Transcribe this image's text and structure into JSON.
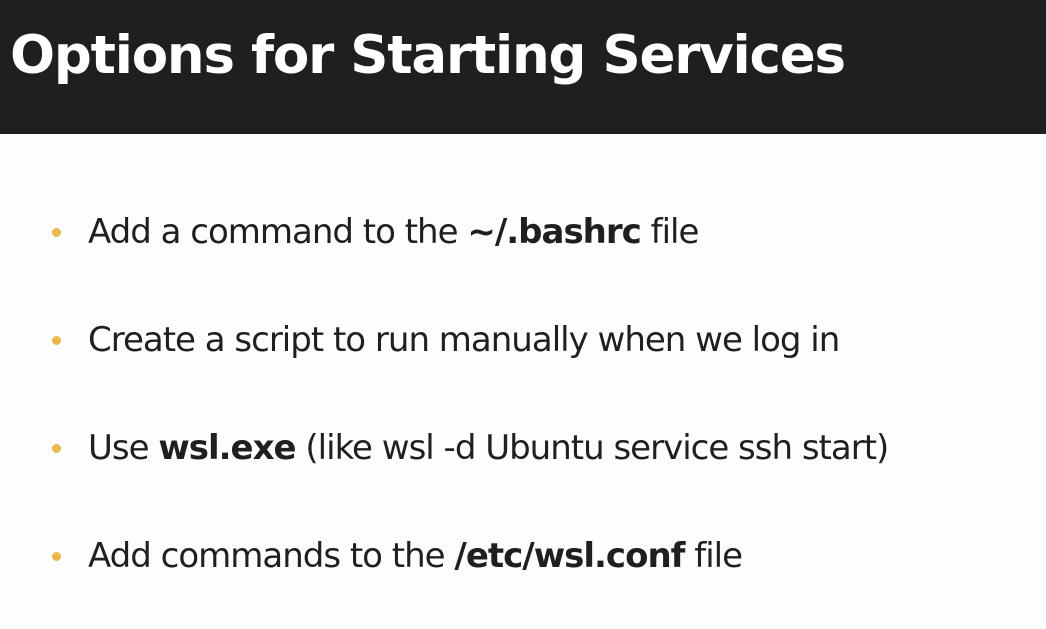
{
  "slide": {
    "title": "Options for Starting Services",
    "bullet_color": "#e8b84a",
    "bullets": [
      {
        "pre": "Add a command to the ",
        "strong": "~/.bashrc",
        "post": " file"
      },
      {
        "pre": "Create a script to run manually when we log in",
        "strong": "",
        "post": ""
      },
      {
        "pre": "Use ",
        "strong": "wsl.exe",
        "post": " (like wsl -d Ubuntu service ssh start)"
      },
      {
        "pre": "Add commands to the ",
        "strong": "/etc/wsl.conf",
        "post": " file"
      }
    ]
  }
}
